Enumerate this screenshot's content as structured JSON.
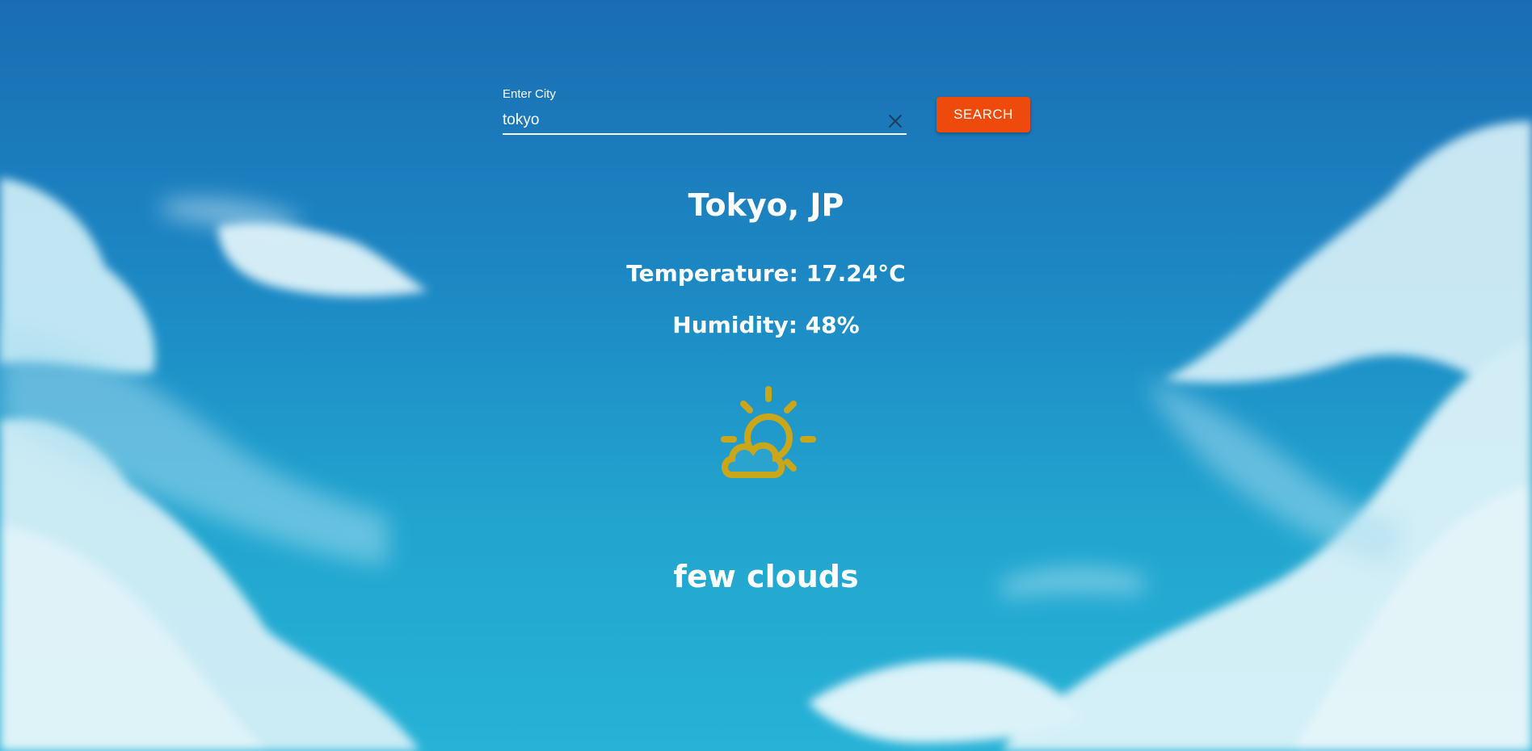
{
  "search": {
    "label": "Enter City",
    "value": "tokyo",
    "button_label": "SEARCH",
    "clear_icon": "close-icon"
  },
  "weather": {
    "location": "Tokyo, JP",
    "temperature": "Temperature: 17.24°C",
    "humidity": "Humidity: 48%",
    "description": "few clouds",
    "icon": "partly-cloudy-icon",
    "icon_color": "#c9a61a"
  },
  "colors": {
    "search_button": "#ee4a0b",
    "text": "#ffffff",
    "sky_top": "#1a6db2",
    "sky_bottom": "#27b2d6"
  }
}
